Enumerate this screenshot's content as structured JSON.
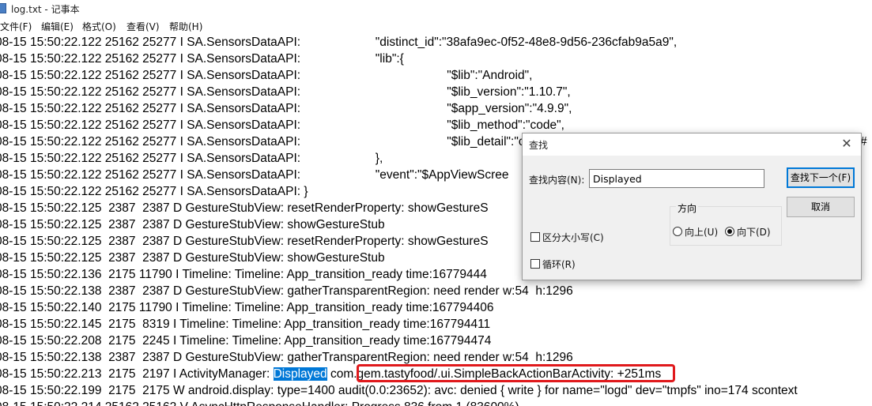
{
  "window": {
    "title": "log.txt - 记事本"
  },
  "menu": [
    "文件(F)",
    "编辑(E)",
    "格式(O)",
    "查看(V)",
    "帮助(H)"
  ],
  "log": {
    "lines": [
      "08-15 15:50:22.122 25162 25277 I SA.SensorsDataAPI:                      \"distinct_id\":\"38afa9ec-0f52-48e8-9d56-236cfab9a5a9\",",
      "08-15 15:50:22.122 25162 25277 I SA.SensorsDataAPI:                      \"lib\":{",
      "08-15 15:50:22.122 25162 25277 I SA.SensorsDataAPI:                                           \"$lib\":\"Android\",",
      "08-15 15:50:22.122 25162 25277 I SA.SensorsDataAPI:                                           \"$lib_version\":\"1.10.7\",",
      "08-15 15:50:22.122 25162 25277 I SA.SensorsDataAPI:                                           \"$app_version\":\"4.9.9\",",
      "08-15 15:50:22.122 25162 25277 I SA.SensorsDataAPI:                                           \"$lib_method\":\"code\",",
      "08-15 15:50:22.122 25162 25277 I SA.SensorsDataAPI:                                           \"$lib_detail\":\"c",
      "08-15 15:50:22.122 25162 25277 I SA.SensorsDataAPI:                      },",
      "08-15 15:50:22.122 25162 25277 I SA.SensorsDataAPI:                      \"event\":\"$AppViewScree",
      "08-15 15:50:22.122 25162 25277 I SA.SensorsDataAPI: }",
      "08-15 15:50:22.125  2387  2387 D GestureStubView: resetRenderProperty: showGestureS",
      "08-15 15:50:22.125  2387  2387 D GestureStubView: showGestureStub",
      "08-15 15:50:22.125  2387  2387 D GestureStubView: resetRenderProperty: showGestureS",
      "08-15 15:50:22.125  2387  2387 D GestureStubView: showGestureStub",
      "08-15 15:50:22.136  2175 11790 I Timeline: Timeline: App_transition_ready time:16779444",
      "08-15 15:50:22.138  2387  2387 D GestureStubView: gatherTransparentRegion: need render w:54  h:1296",
      "08-15 15:50:22.140  2175 11790 I Timeline: Timeline: App_transition_ready time:167794406",
      "08-15 15:50:22.145  2175  8319 I Timeline: Timeline: App_transition_ready time:167794411",
      "08-15 15:50:22.208  2175  2245 I Timeline: Timeline: App_transition_ready time:167794474",
      "08-15 15:50:22.138  2387  2387 D GestureStubView: gatherTransparentRegion: need render w:54  h:1296"
    ],
    "activity_line": {
      "prefix": "08-15 15:50:22.213  2175  2197 I ActivityManager: ",
      "match": "Displayed",
      "boxed": " com.gem.tastyfood/.ui.SimpleBackActionBarActivity: ",
      "suffix": "+251ms"
    },
    "after_lines": [
      "08-15 15:50:22.199  2175  2175 W android.display: type=1400 audit(0.0:23652): avc: denied { write } for name=\"logd\" dev=\"tmpfs\" ino=174 scontext",
      "08-15 15:50:22.214 25162 25162 V AsyncHttpResponseHandler: Progress 836 from 1 (83600%)"
    ],
    "right_fragment": "#"
  },
  "find_dialog": {
    "title": "查找",
    "find_label": "查找内容(N):",
    "find_label_key": "N",
    "find_value": "Displayed",
    "find_next": "查找下一个(F)",
    "cancel": "取消",
    "direction_title": "方向",
    "up": "向上(U)",
    "down": "向下(D)",
    "direction_selected": "down",
    "match_case": "区分大小写(C)",
    "wrap": "循环(R)",
    "match_case_checked": false,
    "wrap_checked": false
  }
}
